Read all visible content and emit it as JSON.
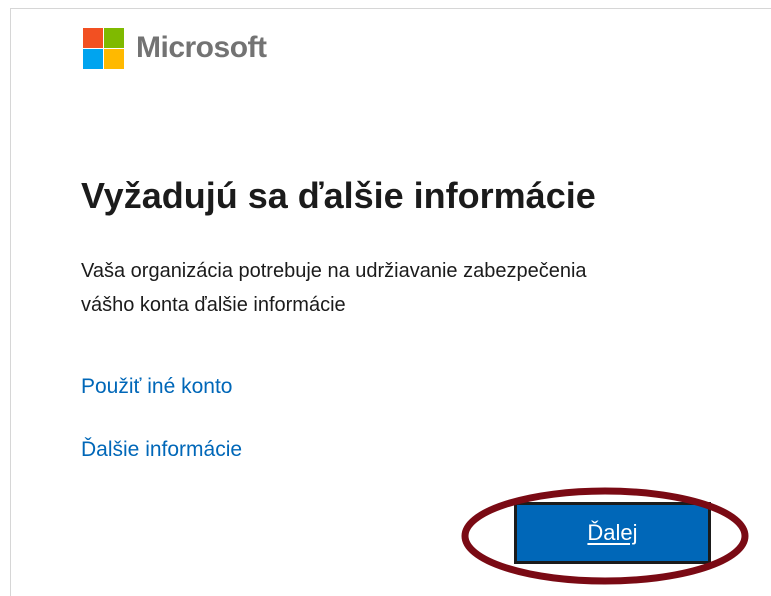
{
  "logo": {
    "text": "Microsoft",
    "colors": [
      "#f25022",
      "#7fba00",
      "#00a4ef",
      "#ffb900"
    ]
  },
  "main": {
    "title": "Vyžadujú sa ďalšie informácie",
    "description": "Vaša organizácia potrebuje na udržiavanie zabezpečenia vášho konta ďalšie informácie",
    "links": {
      "use_other_account": "Použiť iné konto",
      "more_info": "Ďalšie informácie"
    },
    "next_button_label": "Ďalej"
  },
  "colors": {
    "accent": "#0067b8",
    "annotation": "#7a0a14"
  }
}
